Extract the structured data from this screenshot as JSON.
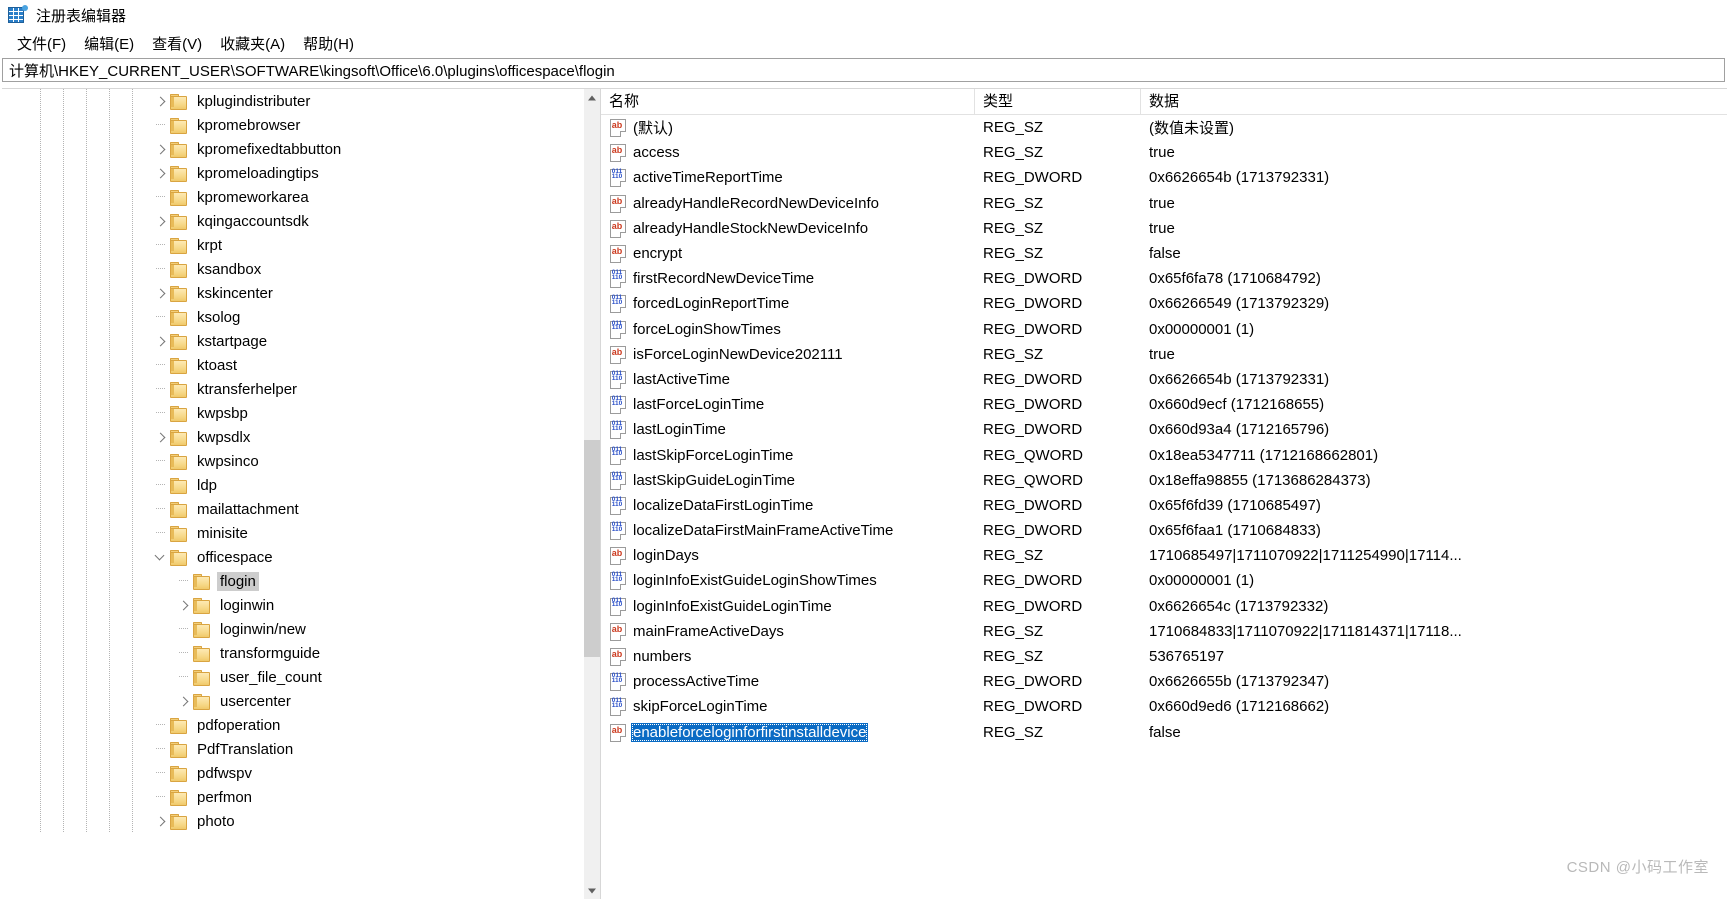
{
  "window": {
    "title": "注册表编辑器",
    "icon": "registry-icon"
  },
  "menu": {
    "items": [
      {
        "label": "文件(F)",
        "name": "menu-file"
      },
      {
        "label": "编辑(E)",
        "name": "menu-edit"
      },
      {
        "label": "查看(V)",
        "name": "menu-view"
      },
      {
        "label": "收藏夹(A)",
        "name": "menu-favorites"
      },
      {
        "label": "帮助(H)",
        "name": "menu-help"
      }
    ]
  },
  "address": {
    "path": "计算机\\HKEY_CURRENT_USER\\SOFTWARE\\kingsoft\\Office\\6.0\\plugins\\officespace\\flogin"
  },
  "tree": {
    "nodes": [
      {
        "label": "kplugindistributer",
        "depth": 1,
        "expandable": true,
        "expanded": false,
        "selected": false
      },
      {
        "label": "kpromebrowser",
        "depth": 1,
        "expandable": false,
        "expanded": false,
        "selected": false
      },
      {
        "label": "kpromefixedtabbutton",
        "depth": 1,
        "expandable": true,
        "expanded": false,
        "selected": false
      },
      {
        "label": "kpromeloadingtips",
        "depth": 1,
        "expandable": true,
        "expanded": false,
        "selected": false
      },
      {
        "label": "kpromeworkarea",
        "depth": 1,
        "expandable": false,
        "expanded": false,
        "selected": false
      },
      {
        "label": "kqingaccountsdk",
        "depth": 1,
        "expandable": true,
        "expanded": false,
        "selected": false
      },
      {
        "label": "krpt",
        "depth": 1,
        "expandable": false,
        "expanded": false,
        "selected": false
      },
      {
        "label": "ksandbox",
        "depth": 1,
        "expandable": false,
        "expanded": false,
        "selected": false
      },
      {
        "label": "kskincenter",
        "depth": 1,
        "expandable": true,
        "expanded": false,
        "selected": false
      },
      {
        "label": "ksolog",
        "depth": 1,
        "expandable": false,
        "expanded": false,
        "selected": false
      },
      {
        "label": "kstartpage",
        "depth": 1,
        "expandable": true,
        "expanded": false,
        "selected": false
      },
      {
        "label": "ktoast",
        "depth": 1,
        "expandable": false,
        "expanded": false,
        "selected": false
      },
      {
        "label": "ktransferhelper",
        "depth": 1,
        "expandable": false,
        "expanded": false,
        "selected": false
      },
      {
        "label": "kwpsbp",
        "depth": 1,
        "expandable": false,
        "expanded": false,
        "selected": false
      },
      {
        "label": "kwpsdlx",
        "depth": 1,
        "expandable": true,
        "expanded": false,
        "selected": false
      },
      {
        "label": "kwpsinco",
        "depth": 1,
        "expandable": false,
        "expanded": false,
        "selected": false
      },
      {
        "label": "ldp",
        "depth": 1,
        "expandable": false,
        "expanded": false,
        "selected": false
      },
      {
        "label": "mailattachment",
        "depth": 1,
        "expandable": false,
        "expanded": false,
        "selected": false
      },
      {
        "label": "minisite",
        "depth": 1,
        "expandable": false,
        "expanded": false,
        "selected": false
      },
      {
        "label": "officespace",
        "depth": 1,
        "expandable": true,
        "expanded": true,
        "selected": false
      },
      {
        "label": "flogin",
        "depth": 2,
        "expandable": false,
        "expanded": false,
        "selected": true
      },
      {
        "label": "loginwin",
        "depth": 2,
        "expandable": true,
        "expanded": false,
        "selected": false
      },
      {
        "label": "loginwin/new",
        "depth": 2,
        "expandable": false,
        "expanded": false,
        "selected": false
      },
      {
        "label": "transformguide",
        "depth": 2,
        "expandable": false,
        "expanded": false,
        "selected": false
      },
      {
        "label": "user_file_count",
        "depth": 2,
        "expandable": false,
        "expanded": false,
        "selected": false
      },
      {
        "label": "usercenter",
        "depth": 2,
        "expandable": true,
        "expanded": false,
        "selected": false
      },
      {
        "label": "pdfoperation",
        "depth": 1,
        "expandable": false,
        "expanded": false,
        "selected": false
      },
      {
        "label": "PdfTranslation",
        "depth": 1,
        "expandable": false,
        "expanded": false,
        "selected": false
      },
      {
        "label": "pdfwspv",
        "depth": 1,
        "expandable": false,
        "expanded": false,
        "selected": false
      },
      {
        "label": "perfmon",
        "depth": 1,
        "expandable": false,
        "expanded": false,
        "selected": false
      },
      {
        "label": "photo",
        "depth": 1,
        "expandable": true,
        "expanded": false,
        "selected": false
      }
    ]
  },
  "list": {
    "columns": [
      {
        "label": "名称",
        "name": "column-name"
      },
      {
        "label": "类型",
        "name": "column-type"
      },
      {
        "label": "数据",
        "name": "column-data"
      }
    ],
    "rows": [
      {
        "name": "(默认)",
        "type": "REG_SZ",
        "data": "(数值未设置)",
        "icon": "string-value-icon",
        "selected": false
      },
      {
        "name": "access",
        "type": "REG_SZ",
        "data": "true",
        "icon": "string-value-icon",
        "selected": false
      },
      {
        "name": "activeTimeReportTime",
        "type": "REG_DWORD",
        "data": "0x6626654b (1713792331)",
        "icon": "binary-value-icon",
        "selected": false
      },
      {
        "name": "alreadyHandleRecordNewDeviceInfo",
        "type": "REG_SZ",
        "data": "true",
        "icon": "string-value-icon",
        "selected": false
      },
      {
        "name": "alreadyHandleStockNewDeviceInfo",
        "type": "REG_SZ",
        "data": "true",
        "icon": "string-value-icon",
        "selected": false
      },
      {
        "name": "encrypt",
        "type": "REG_SZ",
        "data": "false",
        "icon": "string-value-icon",
        "selected": false
      },
      {
        "name": "firstRecordNewDeviceTime",
        "type": "REG_DWORD",
        "data": "0x65f6fa78 (1710684792)",
        "icon": "binary-value-icon",
        "selected": false
      },
      {
        "name": "forcedLoginReportTime",
        "type": "REG_DWORD",
        "data": "0x66266549 (1713792329)",
        "icon": "binary-value-icon",
        "selected": false
      },
      {
        "name": "forceLoginShowTimes",
        "type": "REG_DWORD",
        "data": "0x00000001 (1)",
        "icon": "binary-value-icon",
        "selected": false
      },
      {
        "name": "isForceLoginNewDevice202111",
        "type": "REG_SZ",
        "data": "true",
        "icon": "string-value-icon",
        "selected": false
      },
      {
        "name": "lastActiveTime",
        "type": "REG_DWORD",
        "data": "0x6626654b (1713792331)",
        "icon": "binary-value-icon",
        "selected": false
      },
      {
        "name": "lastForceLoginTime",
        "type": "REG_DWORD",
        "data": "0x660d9ecf (1712168655)",
        "icon": "binary-value-icon",
        "selected": false
      },
      {
        "name": "lastLoginTime",
        "type": "REG_DWORD",
        "data": "0x660d93a4 (1712165796)",
        "icon": "binary-value-icon",
        "selected": false
      },
      {
        "name": "lastSkipForceLoginTime",
        "type": "REG_QWORD",
        "data": "0x18ea5347711 (1712168662801)",
        "icon": "binary-value-icon",
        "selected": false
      },
      {
        "name": "lastSkipGuideLoginTime",
        "type": "REG_QWORD",
        "data": "0x18effa98855 (1713686284373)",
        "icon": "binary-value-icon",
        "selected": false
      },
      {
        "name": "localizeDataFirstLoginTime",
        "type": "REG_DWORD",
        "data": "0x65f6fd39 (1710685497)",
        "icon": "binary-value-icon",
        "selected": false
      },
      {
        "name": "localizeDataFirstMainFrameActiveTime",
        "type": "REG_DWORD",
        "data": "0x65f6faa1 (1710684833)",
        "icon": "binary-value-icon",
        "selected": false
      },
      {
        "name": "loginDays",
        "type": "REG_SZ",
        "data": "1710685497|1711070922|1711254990|17114...",
        "icon": "string-value-icon",
        "selected": false
      },
      {
        "name": "loginInfoExistGuideLoginShowTimes",
        "type": "REG_DWORD",
        "data": "0x00000001 (1)",
        "icon": "binary-value-icon",
        "selected": false
      },
      {
        "name": "loginInfoExistGuideLoginTime",
        "type": "REG_DWORD",
        "data": "0x6626654c (1713792332)",
        "icon": "binary-value-icon",
        "selected": false
      },
      {
        "name": "mainFrameActiveDays",
        "type": "REG_SZ",
        "data": "1710684833|1711070922|1711814371|17118...",
        "icon": "string-value-icon",
        "selected": false
      },
      {
        "name": "numbers",
        "type": "REG_SZ",
        "data": "536765197",
        "icon": "string-value-icon",
        "selected": false
      },
      {
        "name": "processActiveTime",
        "type": "REG_DWORD",
        "data": "0x6626655b (1713792347)",
        "icon": "binary-value-icon",
        "selected": false
      },
      {
        "name": "skipForceLoginTime",
        "type": "REG_DWORD",
        "data": "0x660d9ed6 (1712168662)",
        "icon": "binary-value-icon",
        "selected": false
      },
      {
        "name": "enableforceloginforfirstinstalldevice",
        "type": "REG_SZ",
        "data": "false",
        "icon": "string-value-icon",
        "selected": true
      }
    ]
  },
  "scrollbar": {
    "tree_up": "scroll-up-arrow",
    "tree_down": "scroll-down-arrow"
  },
  "watermark": {
    "text": "CSDN @小码工作室"
  },
  "colors": {
    "selection_focused": "#0a6bc4",
    "selection_unfocused": "#cdcdcd",
    "folder": "#f7d98a",
    "string_icon": "#cc3b20",
    "binary_icon": "#2b50c8"
  }
}
